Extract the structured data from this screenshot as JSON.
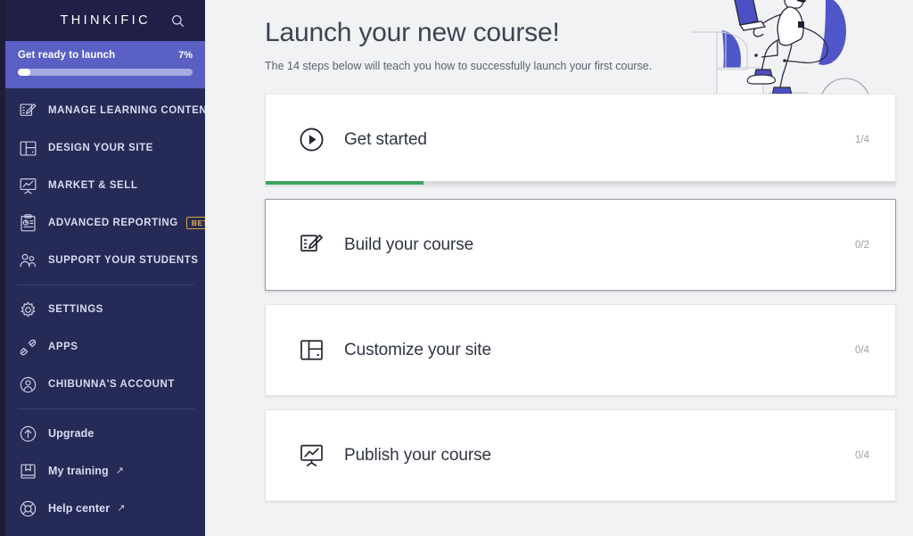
{
  "sidebar": {
    "brand": "THINKIFIC",
    "search_icon": "search-icon",
    "launch": {
      "label": "Get ready to launch",
      "percent_label": "7%",
      "percent_value": 7,
      "bar_color": "#ffffff",
      "banner_color": "#5a5fc4"
    },
    "primary_items": [
      {
        "label": "MANAGE LEARNING CONTENT",
        "icon": "note-edit-icon"
      },
      {
        "label": "DESIGN YOUR SITE",
        "icon": "layout-panels-icon"
      },
      {
        "label": "MARKET & SELL",
        "icon": "presentation-chart-icon"
      },
      {
        "label": "ADVANCED REPORTING",
        "icon": "clipboard-report-icon",
        "badge": "BETA"
      },
      {
        "label": "SUPPORT YOUR STUDENTS",
        "icon": "people-icon"
      }
    ],
    "secondary_items": [
      {
        "label": "SETTINGS",
        "icon": "gear-icon"
      },
      {
        "label": "APPS",
        "icon": "plug-connect-icon"
      },
      {
        "label": "CHIBUNNA'S ACCOUNT",
        "icon": "user-circle-icon"
      }
    ],
    "footer_items": [
      {
        "label": "Upgrade",
        "icon": "arrow-up-circle-icon",
        "external": false
      },
      {
        "label": "My training",
        "icon": "book-icon",
        "external": true
      },
      {
        "label": "Help center",
        "icon": "lifebuoy-icon",
        "external": true
      }
    ],
    "external_arrow": "↗"
  },
  "main": {
    "title": "Launch your new course!",
    "subtitle": "The 14 steps below will teach you how to successfully launch your first course.",
    "illustration": "person-climbing-steps-with-laptop-illustration",
    "cards": [
      {
        "title": "Get started",
        "icon": "play-circle-icon",
        "count": "1/4",
        "completed": 1,
        "total": 4,
        "progress_percent": 25,
        "progress_color": "#3da35d",
        "show_progress": true,
        "hovered": false
      },
      {
        "title": "Build your course",
        "icon": "note-edit-icon",
        "count": "0/2",
        "completed": 0,
        "total": 2,
        "progress_percent": 0,
        "progress_color": "#3da35d",
        "show_progress": false,
        "hovered": true
      },
      {
        "title": "Customize your site",
        "icon": "layout-panels-icon",
        "count": "0/4",
        "completed": 0,
        "total": 4,
        "progress_percent": 0,
        "progress_color": "#3da35d",
        "show_progress": false,
        "hovered": false
      },
      {
        "title": "Publish your course",
        "icon": "presentation-chart-icon",
        "count": "0/4",
        "completed": 0,
        "total": 4,
        "progress_percent": 0,
        "progress_color": "#3da35d",
        "show_progress": false,
        "hovered": false
      }
    ]
  },
  "colors": {
    "sidebar_bg": "#262a56",
    "sidebar_brandbar_bg": "#201f45",
    "accent_indigo": "#5a5fc4",
    "beta_gold": "#e8b24d",
    "progress_green": "#3da35d",
    "main_bg": "#f1f2f4"
  }
}
